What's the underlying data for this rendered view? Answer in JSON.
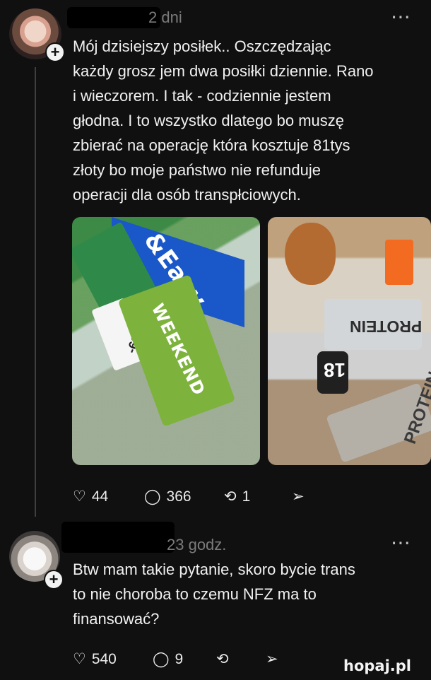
{
  "posts": [
    {
      "time": "2 dni",
      "text": "Mój dzisiejszy posiłek.. Oszczędzając\nkażdy grosz jem dwa posiłki dziennie. Rano\ni wieczorem. I tak - codziennie jestem\ngłodna. I to wszystko dlatego bo muszę\nzbierać na operację która kosztuje 81tys\nzłoty bo moje państwo nie refunduje\noperacji dla osób transpłciowych.",
      "likes": "44",
      "comments": "366",
      "reposts": "1"
    },
    {
      "time": "23 godz.",
      "text": "Btw mam takie pytanie, skoro bycie trans\nto nie choroba to czemu NFZ ma to\nfinansować?",
      "likes": "540",
      "comments": "9"
    }
  ],
  "images": {
    "left": {
      "brand": "&Easy",
      "product": "WEEKEND",
      "price": "-69%"
    },
    "right": {
      "product": "PROTEIN",
      "badge": "18"
    }
  },
  "watermark": "hopaj.pl"
}
